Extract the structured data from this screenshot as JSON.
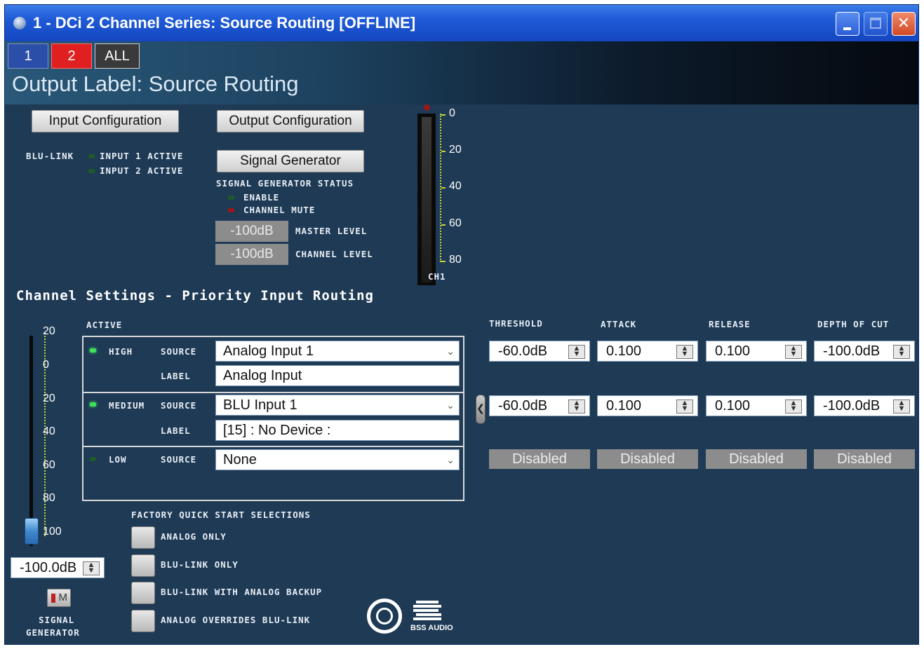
{
  "window": {
    "title": "1 - DCi 2 Channel Series: Source Routing [OFFLINE]"
  },
  "header": {
    "tabs": [
      {
        "label": "1"
      },
      {
        "label": "2"
      },
      {
        "label": "ALL"
      }
    ],
    "output_label": "Output Label: Source Routing"
  },
  "config": {
    "input_configuration": "Input Configuration",
    "output_configuration": "Output Configuration",
    "signal_generator": "Signal Generator",
    "blu_link_label": "BLU-LINK",
    "input1_active": "INPUT 1 ACTIVE",
    "input2_active": "INPUT 2 ACTIVE",
    "sg_status_title": "SIGNAL GENERATOR STATUS",
    "enable_label": "ENABLE",
    "channel_mute_label": "CHANNEL MUTE",
    "master_level_value": "-100dB",
    "master_level_label": "MASTER LEVEL",
    "channel_level_value": "-100dB",
    "channel_level_label": "CHANNEL LEVEL"
  },
  "meter": {
    "ticks": [
      "0",
      "20",
      "40",
      "60",
      "80"
    ],
    "channel_label": "CH1"
  },
  "channel_settings": {
    "title": "Channel Settings - Priority Input Routing",
    "active_header": "ACTIVE",
    "source_label": "SOURCE",
    "label_label": "LABEL",
    "rows": [
      {
        "priority": "HIGH",
        "source": "Analog Input 1",
        "label": "Analog Input"
      },
      {
        "priority": "MEDIUM",
        "source": "BLU Input 1",
        "label": "[15] : No Device :"
      },
      {
        "priority": "LOW",
        "source": "None"
      }
    ],
    "columns": [
      "THRESHOLD",
      "ATTACK",
      "RELEASE",
      "DEPTH OF CUT"
    ],
    "high_values": [
      "-60.0dB",
      "0.100",
      "0.100",
      "-100.0dB"
    ],
    "medium_values": [
      "-60.0dB",
      "0.100",
      "0.100",
      "-100.0dB"
    ],
    "low_values": [
      "Disabled",
      "Disabled",
      "Disabled",
      "Disabled"
    ]
  },
  "fader": {
    "ticks": [
      "20",
      "0",
      "20",
      "40",
      "60",
      "80",
      "100"
    ],
    "value": "-100.0dB",
    "mute_label": "M",
    "signal_generator_label_1": "SIGNAL",
    "signal_generator_label_2": "GENERATOR"
  },
  "quick_start": {
    "title": "FACTORY QUICK START SELECTIONS",
    "options": [
      "ANALOG ONLY",
      "BLU-LINK ONLY",
      "BLU-LINK WITH ANALOG BACKUP",
      "ANALOG OVERRIDES BLU-LINK"
    ]
  },
  "logo": {
    "text": "BSS AUDIO"
  }
}
